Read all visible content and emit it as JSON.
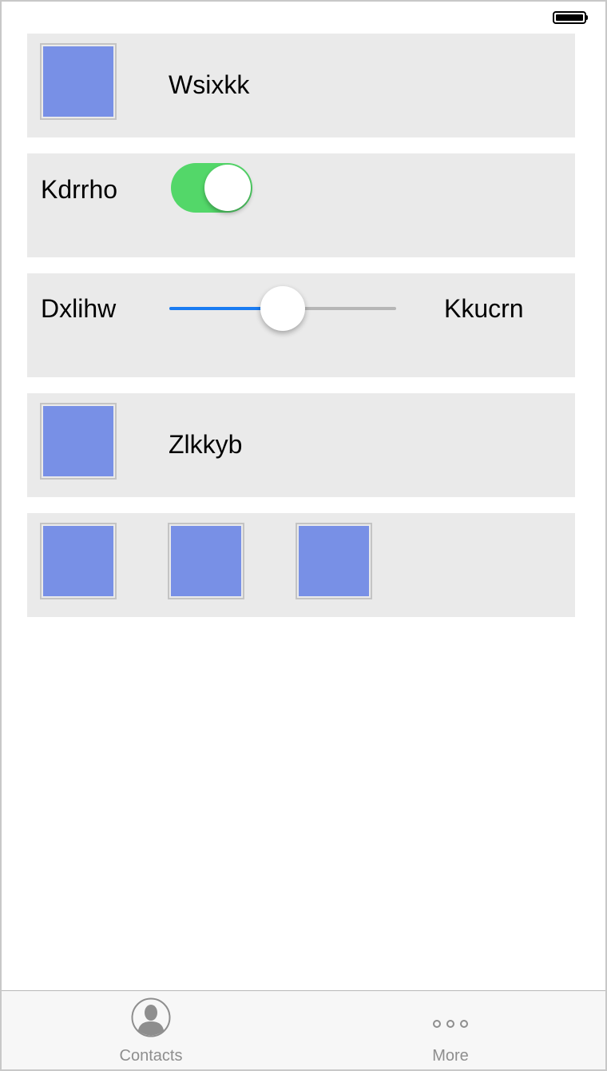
{
  "status_bar": {
    "battery_icon": "battery-full-icon"
  },
  "rows": [
    {
      "type": "image-label",
      "label": "Wsixkk",
      "image_color": "#7890e6"
    },
    {
      "type": "switch",
      "label": "Kdrrho",
      "switch_on": true,
      "switch_color": "#53d769"
    },
    {
      "type": "slider",
      "label": "Dxlihw",
      "trailing_label": "Kkucrn",
      "slider_value": 0.5,
      "slider_color": "#1a7cf2"
    },
    {
      "type": "image-label",
      "label": "Zlkkyb",
      "image_color": "#7890e6"
    },
    {
      "type": "images",
      "image_count": 3,
      "image_color": "#7890e6"
    }
  ],
  "tabbar": {
    "tabs": [
      {
        "label": "Contacts",
        "icon": "contacts-icon"
      },
      {
        "label": "More",
        "icon": "more-icon"
      }
    ]
  }
}
